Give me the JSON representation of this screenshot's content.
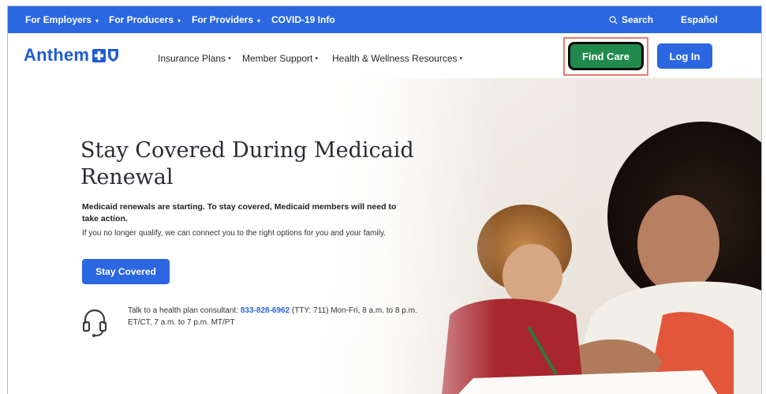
{
  "colors": {
    "primary_blue": "#2b67e0",
    "find_care_green": "#1f8a4c",
    "highlight_box": "#e87c6c",
    "shield_blue": "#1e5bd6"
  },
  "utility_bar": {
    "items": [
      {
        "label": "For Employers",
        "caret": "▾"
      },
      {
        "label": "For Producers",
        "caret": "▾"
      },
      {
        "label": "For Providers",
        "caret": "▾"
      },
      {
        "label": "COVID-19 Info"
      }
    ],
    "search_label": "Search",
    "search_icon": "search-icon",
    "language_label": "Español"
  },
  "header": {
    "logo_text": "Anthem",
    "nav": [
      {
        "label": "Insurance Plans",
        "caret": "▾"
      },
      {
        "label": "Member Support",
        "caret": "▾"
      },
      {
        "label": "Health & Wellness Resources",
        "caret": "▾"
      }
    ],
    "find_care_label": "Find Care",
    "login_label": "Log In"
  },
  "hero": {
    "title": "Stay Covered During Medicaid Renewal",
    "lead": "Medicaid renewals are starting. To stay covered, Medicaid members will need to take action.",
    "sub": "If you no longer qualify, we can connect you to the right options for you and your family.",
    "cta_label": "Stay Covered",
    "consult": {
      "prefix": "Talk to a health plan consultant: ",
      "phone": "833-828-6962",
      "suffix": " (TTY: 711) Mon-Fri, 8 a.m. to 8 p.m. ET/CT, 7 a.m. to 7 p.m. MT/PT",
      "icon": "headset-icon"
    },
    "photo_icon": "hero-photo"
  }
}
